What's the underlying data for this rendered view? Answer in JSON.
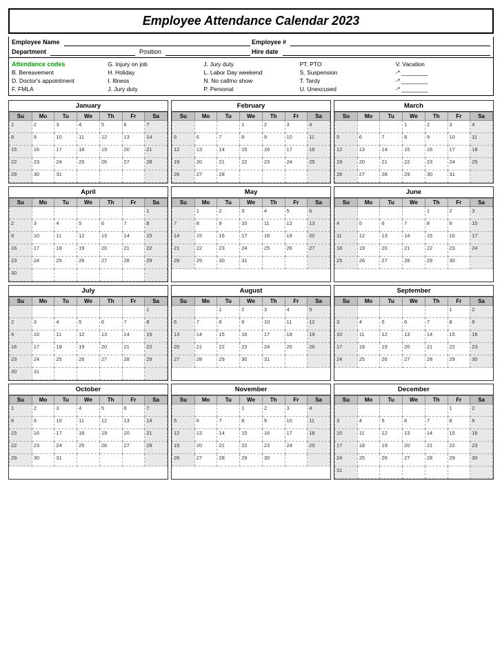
{
  "title": "Employee Attendance Calendar 2023",
  "fields": {
    "employee_name_label": "Employee Name",
    "department_label": "Department",
    "position_label": "Position",
    "employee_num_label": "Employee #",
    "hire_date_label": "Hire date"
  },
  "codes": {
    "title": "Attendance codes",
    "col1": [
      "B. Bereavement",
      "D. Doctor's appointment",
      "F. FMLA"
    ],
    "col2": [
      "G. Injury on job",
      "H. Holiday",
      "I. Illness",
      "J. Jury duty"
    ],
    "col3": [
      "J. Jury duty",
      "L. Labor Day weekend",
      "N. No call/no show",
      "P. Personal"
    ],
    "col4": [
      "PT. PTO",
      "S. Suspension",
      "T. Tardy",
      "U. Unexcused"
    ],
    "col5": [
      "V. Vacation",
      "-* ________",
      "-* ________",
      "-* ________"
    ]
  },
  "months": [
    {
      "name": "January",
      "days": [
        "Su",
        "Mo",
        "Tu",
        "We",
        "Th",
        "Fr",
        "Sa"
      ],
      "weeks": [
        [
          "1",
          "2",
          "3",
          "4",
          "5",
          "6",
          "7"
        ],
        [
          "8",
          "9",
          "10",
          "11",
          "12",
          "13",
          "14"
        ],
        [
          "15",
          "16",
          "17",
          "18",
          "19",
          "20",
          "21"
        ],
        [
          "22",
          "23",
          "24",
          "25",
          "26",
          "27",
          "28"
        ],
        [
          "29",
          "30",
          "31",
          "",
          "",
          "",
          ""
        ]
      ]
    },
    {
      "name": "February",
      "days": [
        "Su",
        "Mo",
        "Tu",
        "We",
        "Th",
        "Fr",
        "Sa"
      ],
      "weeks": [
        [
          "",
          "",
          "",
          "1",
          "2",
          "3",
          "4"
        ],
        [
          "5",
          "6",
          "7",
          "8",
          "9",
          "10",
          "11"
        ],
        [
          "12",
          "13",
          "14",
          "15",
          "16",
          "17",
          "18"
        ],
        [
          "19",
          "20",
          "21",
          "22",
          "23",
          "24",
          "25"
        ],
        [
          "26",
          "27",
          "28",
          "",
          "",
          "",
          ""
        ]
      ]
    },
    {
      "name": "March",
      "days": [
        "Su",
        "Mo",
        "Tu",
        "We",
        "Th",
        "Fr",
        "Sa"
      ],
      "weeks": [
        [
          "",
          "",
          "",
          "1",
          "2",
          "3",
          "4"
        ],
        [
          "5",
          "6",
          "7",
          "8",
          "9",
          "10",
          "11"
        ],
        [
          "12",
          "13",
          "14",
          "15",
          "16",
          "17",
          "18"
        ],
        [
          "19",
          "20",
          "21",
          "22",
          "23",
          "24",
          "25"
        ],
        [
          "26",
          "27",
          "28",
          "29",
          "30",
          "31",
          ""
        ]
      ]
    },
    {
      "name": "April",
      "days": [
        "Su",
        "Mo",
        "Tu",
        "We",
        "Th",
        "Fr",
        "Sa"
      ],
      "weeks": [
        [
          "",
          "",
          "",
          "",
          "",
          "",
          "1"
        ],
        [
          "2",
          "3",
          "4",
          "5",
          "6",
          "7",
          "8"
        ],
        [
          "9",
          "10",
          "11",
          "12",
          "13",
          "14",
          "15"
        ],
        [
          "16",
          "17",
          "18",
          "19",
          "20",
          "21",
          "22"
        ],
        [
          "23",
          "24",
          "25",
          "26",
          "27",
          "28",
          "29"
        ],
        [
          "30",
          "",
          "",
          "",
          "",
          "",
          ""
        ]
      ]
    },
    {
      "name": "May",
      "days": [
        "Su",
        "Mo",
        "Tu",
        "We",
        "Th",
        "Fr",
        "Sa"
      ],
      "weeks": [
        [
          "",
          "1",
          "2",
          "3",
          "4",
          "5",
          "6"
        ],
        [
          "7",
          "8",
          "9",
          "10",
          "11",
          "12",
          "13"
        ],
        [
          "14",
          "15",
          "16",
          "17",
          "18",
          "19",
          "20"
        ],
        [
          "21",
          "22",
          "23",
          "24",
          "25",
          "26",
          "27"
        ],
        [
          "28",
          "29",
          "30",
          "31",
          "",
          "",
          ""
        ]
      ]
    },
    {
      "name": "June",
      "days": [
        "Su",
        "Mo",
        "Tu",
        "We",
        "Th",
        "Fr",
        "Sa"
      ],
      "weeks": [
        [
          "",
          "",
          "",
          "",
          "1",
          "2",
          "3"
        ],
        [
          "4",
          "5",
          "6",
          "7",
          "8",
          "9",
          "10"
        ],
        [
          "11",
          "12",
          "13",
          "14",
          "15",
          "16",
          "17"
        ],
        [
          "18",
          "19",
          "20",
          "21",
          "22",
          "23",
          "24"
        ],
        [
          "25",
          "26",
          "27",
          "28",
          "29",
          "30",
          ""
        ]
      ]
    },
    {
      "name": "July",
      "days": [
        "Su",
        "Mo",
        "Tu",
        "We",
        "Th",
        "Fr",
        "Sa"
      ],
      "weeks": [
        [
          "",
          "",
          "",
          "",
          "",
          "",
          "1"
        ],
        [
          "2",
          "3",
          "4",
          "5",
          "6",
          "7",
          "8"
        ],
        [
          "9",
          "10",
          "11",
          "12",
          "13",
          "14",
          "15"
        ],
        [
          "16",
          "17",
          "18",
          "19",
          "20",
          "21",
          "22"
        ],
        [
          "23",
          "24",
          "25",
          "26",
          "27",
          "28",
          "29"
        ],
        [
          "30",
          "31",
          "",
          "",
          "",
          "",
          ""
        ]
      ]
    },
    {
      "name": "August",
      "days": [
        "Su",
        "Mo",
        "Tu",
        "We",
        "Th",
        "Fr",
        "Sa"
      ],
      "weeks": [
        [
          "",
          "",
          "1",
          "2",
          "3",
          "4",
          "5"
        ],
        [
          "6",
          "7",
          "8",
          "9",
          "10",
          "11",
          "12"
        ],
        [
          "13",
          "14",
          "15",
          "16",
          "17",
          "18",
          "19"
        ],
        [
          "20",
          "21",
          "22",
          "23",
          "24",
          "25",
          "26"
        ],
        [
          "27",
          "28",
          "29",
          "30",
          "31",
          "",
          ""
        ]
      ]
    },
    {
      "name": "September",
      "days": [
        "Su",
        "Mo",
        "Tu",
        "We",
        "Th",
        "Fr",
        "Sa"
      ],
      "weeks": [
        [
          "",
          "",
          "",
          "",
          "",
          "1",
          "2"
        ],
        [
          "3",
          "4",
          "5",
          "6",
          "7",
          "8",
          "9"
        ],
        [
          "10",
          "11",
          "12",
          "13",
          "14",
          "15",
          "16"
        ],
        [
          "17",
          "18",
          "19",
          "20",
          "21",
          "22",
          "23"
        ],
        [
          "24",
          "25",
          "26",
          "27",
          "28",
          "29",
          "30"
        ]
      ]
    },
    {
      "name": "October",
      "days": [
        "Su",
        "Mo",
        "Tu",
        "We",
        "Th",
        "Fr",
        "Sa"
      ],
      "weeks": [
        [
          "1",
          "2",
          "3",
          "4",
          "5",
          "6",
          "7"
        ],
        [
          "8",
          "9",
          "10",
          "11",
          "12",
          "13",
          "14"
        ],
        [
          "15",
          "16",
          "17",
          "18",
          "19",
          "20",
          "21"
        ],
        [
          "22",
          "23",
          "24",
          "25",
          "26",
          "27",
          "28"
        ],
        [
          "29",
          "30",
          "31",
          "",
          "",
          "",
          ""
        ]
      ]
    },
    {
      "name": "November",
      "days": [
        "Su",
        "Mo",
        "Tu",
        "We",
        "Th",
        "Fr",
        "Sa"
      ],
      "weeks": [
        [
          "",
          "",
          "",
          "1",
          "2",
          "3",
          "4"
        ],
        [
          "5",
          "6",
          "7",
          "8",
          "9",
          "10",
          "11"
        ],
        [
          "12",
          "13",
          "14",
          "15",
          "16",
          "17",
          "18"
        ],
        [
          "19",
          "20",
          "21",
          "22",
          "23",
          "24",
          "25"
        ],
        [
          "26",
          "27",
          "28",
          "29",
          "30",
          "",
          ""
        ]
      ]
    },
    {
      "name": "December",
      "days": [
        "Su",
        "Mo",
        "Tu",
        "We",
        "Th",
        "Fr",
        "Sa"
      ],
      "weeks": [
        [
          "",
          "",
          "",
          "",
          "",
          "1",
          "2"
        ],
        [
          "3",
          "4",
          "5",
          "6",
          "7",
          "8",
          "9"
        ],
        [
          "10",
          "11",
          "12",
          "13",
          "14",
          "15",
          "16"
        ],
        [
          "17",
          "18",
          "19",
          "20",
          "21",
          "22",
          "23"
        ],
        [
          "24",
          "25",
          "26",
          "27",
          "28",
          "29",
          "30"
        ],
        [
          "31",
          "",
          "",
          "",
          "",
          "",
          ""
        ]
      ]
    }
  ]
}
